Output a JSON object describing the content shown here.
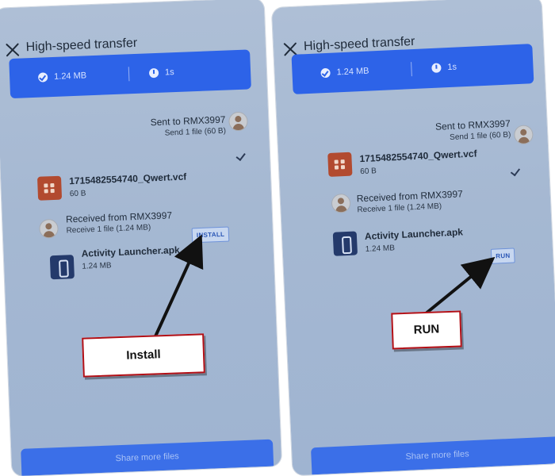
{
  "left": {
    "title": "High-speed transfer",
    "stats": {
      "size": "1.24 MB",
      "time": "1s"
    },
    "sent": {
      "title": "Sent to RMX3997",
      "sub": "Send 1 file (60 B)"
    },
    "vcf": {
      "name": "1715482554740_Qwert.vcf",
      "size": "60 B"
    },
    "received": {
      "title": "Received from RMX3997",
      "sub": "Receive 1 file (1.24 MB)"
    },
    "apk": {
      "name": "Activity Launcher.apk",
      "size": "1.24 MB"
    },
    "action_label": "INSTALL",
    "share_label": "Share more files",
    "callout": "Install"
  },
  "right": {
    "title": "High-speed transfer",
    "stats": {
      "size": "1.24 MB",
      "time": "1s"
    },
    "sent": {
      "title": "Sent to RMX3997",
      "sub": "Send 1 file (60 B)"
    },
    "vcf": {
      "name": "1715482554740_Qwert.vcf",
      "size": "60 B"
    },
    "received": {
      "title": "Received from RMX3997",
      "sub": "Receive 1 file (1.24 MB)"
    },
    "apk": {
      "name": "Activity Launcher.apk",
      "size": "1.24 MB"
    },
    "action_label": "RUN",
    "share_label": "Share more files",
    "callout": "RUN"
  },
  "icons": {
    "close": "close-icon",
    "check": "check-circle-icon",
    "clock": "clock-icon",
    "avatar": "avatar-icon",
    "vcf": "contact-file-icon",
    "apk": "apk-file-icon"
  },
  "colors": {
    "accent": "#2d63e8",
    "screen": "#a5b8d2",
    "callout_border": "#b20f16"
  }
}
